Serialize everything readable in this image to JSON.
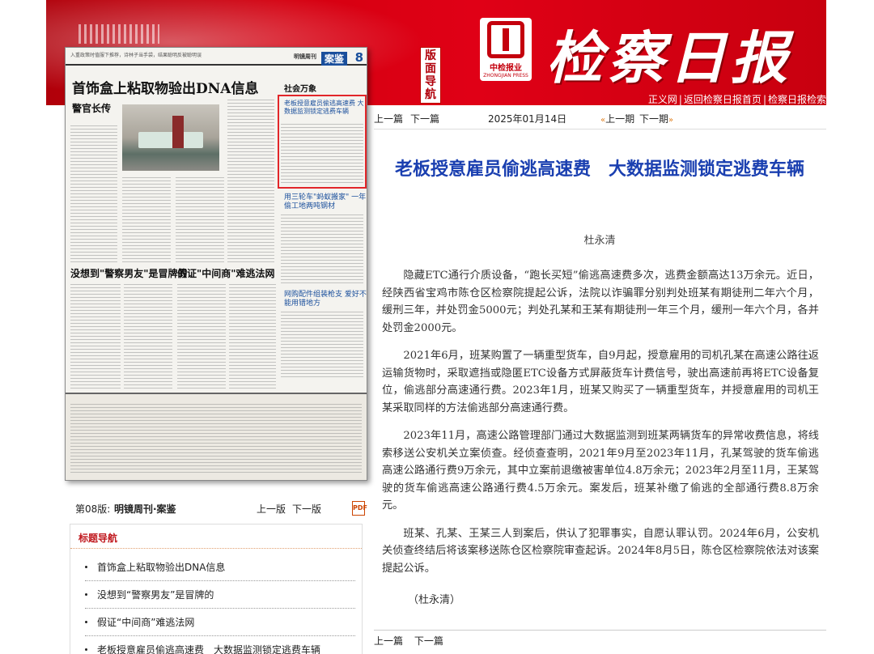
{
  "header": {
    "nav_vertical": [
      "版",
      "面",
      "导",
      "航"
    ],
    "press_name_cn": "中检报业",
    "press_name_en": "ZHONGJIAN PRESS",
    "masthead": "检察日报",
    "links": [
      "正义网",
      "返回检察日报首页",
      "检察日报检索"
    ]
  },
  "paper_image": {
    "top_small": "入重政策时值服下推荐，诗林子当手袋，结果聪明反被聪明误",
    "mirror_label": "明镜周刊",
    "section_tag": "案鉴",
    "page_number": "8",
    "headline": "首饰盒上粘取物验出DNA信息",
    "subhead": "警官长传",
    "social": "社会万象",
    "box_title": "老板授意雇员偷逃高速费 大数据监测锁定逃费车辆",
    "mid1": "用三轮车\"蚂蚁搬家\" 一年偷工地两吨钢材",
    "mid2": "网购配件组装枪支 爱好不能用错地方",
    "h3a": "没想到\"警察男友\"是冒牌的",
    "h3b": "假证\"中间商\"难逃法网"
  },
  "page_meta": {
    "page_no": "第08版:",
    "page_name": "明镜周刊·案鉴",
    "prev": "上一版",
    "next": "下一版",
    "pdf_icon": "PDF"
  },
  "title_nav": {
    "heading": "标题导航",
    "items": [
      "首饰盒上粘取物验出DNA信息",
      "没想到“警察男友”是冒牌的",
      "假证“中间商”难逃法网",
      "老板授意雇员偷逃高速费　大数据监测锁定逃费车辆"
    ]
  },
  "article_nav": {
    "prev_article": "上一篇",
    "next_article": "下一篇",
    "date": "2025年01月14日",
    "prev_issue": "上一期",
    "next_issue": "下一期"
  },
  "article": {
    "title": "老板授意雇员偷逃高速费　大数据监测锁定逃费车辆",
    "author": "杜永清",
    "paragraphs": [
      "隐藏ETC通行介质设备，“跑长买短”偷逃高速费多次，逃费金额高达13万余元。近日，经陕西省宝鸡市陈仓区检察院提起公诉，法院以诈骗罪分别判处班某有期徒刑二年六个月，缓刑三年，并处罚金5000元；判处孔某和王某有期徒刑一年三个月，缓刑一年六个月，各并处罚金2000元。",
      "2021年6月，班某购置了一辆重型货车，自9月起，授意雇用的司机孔某在高速公路往返运输货物时，采取遮挡或隐匿ETC设备方式屏蔽货车计费信号，驶出高速前再将ETC设备复位，偷逃部分高速通行费。2023年1月，班某又购买了一辆重型货车，并授意雇用的司机王某采取同样的方法偷逃部分高速通行费。",
      "2023年11月，高速公路管理部门通过大数据监测到班某两辆货车的异常收费信息，将线索移送公安机关立案侦查。经侦查查明，2021年9月至2023年11月，孔某驾驶的货车偷逃高速公路通行费9万余元，其中立案前退缴被害单位4.8万余元；2023年2月至11月，王某驾驶的货车偷逃高速公路通行费4.5万余元。案发后，班某补缴了偷逃的全部通行费8.8万余元。",
      "班某、孔某、王某三人到案后，供认了犯罪事实，自愿认罪认罚。2024年6月，公安机关侦查终结后将该案移送陈仓区检察院审查起诉。2024年8月5日，陈仓区检察院依法对该案提起公诉。"
    ],
    "signature": "（杜永清）"
  },
  "bottom_nav": {
    "prev_article": "上一篇",
    "next_article": "下一篇"
  },
  "colors": {
    "banner_red": "#d40010",
    "title_blue": "#1a3fb0",
    "highlight_red": "#e2262a",
    "nav_heading_red": "#c0181e"
  }
}
